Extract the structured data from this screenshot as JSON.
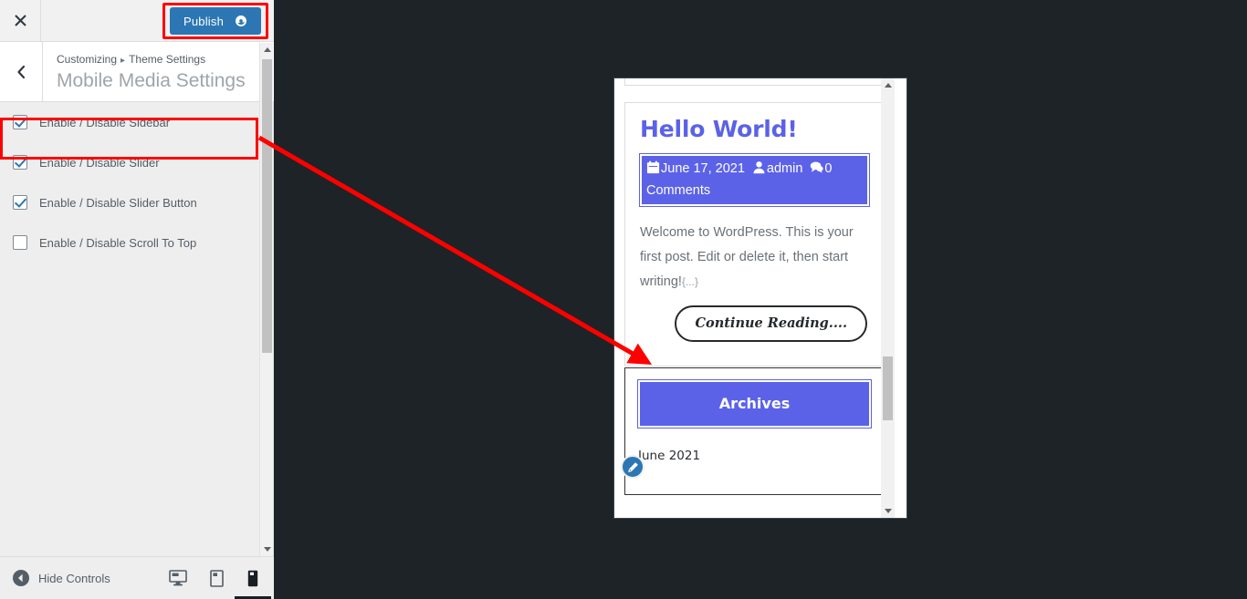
{
  "customizer": {
    "close_icon": "close-icon",
    "publish_label": "Publish",
    "publish_gear_icon": "gear-icon",
    "back_icon": "chevron-left-icon",
    "breadcrumb": {
      "root": "Customizing",
      "separator": "▸",
      "section": "Theme Settings"
    },
    "panel_title": "Mobile Media Settings",
    "options": [
      {
        "label": "Enable / Disable Sidebar",
        "checked": true
      },
      {
        "label": "Enable / Disable Slider",
        "checked": true
      },
      {
        "label": "Enable / Disable Slider Button",
        "checked": true
      },
      {
        "label": "Enable / Disable Scroll To Top",
        "checked": false
      }
    ],
    "footer": {
      "hide_controls_label": "Hide Controls",
      "hide_controls_icon": "collapse-left-icon",
      "devices": [
        {
          "name": "desktop",
          "icon": "desktop-icon",
          "active": false
        },
        {
          "name": "tablet",
          "icon": "tablet-icon",
          "active": false
        },
        {
          "name": "mobile",
          "icon": "mobile-icon",
          "active": true
        }
      ]
    },
    "scrollbar": {
      "up_icon": "scroll-up-arrow-icon",
      "down_icon": "scroll-down-arrow-icon"
    }
  },
  "preview": {
    "device": "mobile",
    "post": {
      "title": "Hello World!",
      "meta": {
        "date_icon": "calendar-icon",
        "date": "June 17, 2021",
        "author_icon": "user-icon",
        "author": "admin",
        "comments_icon": "comment-icon",
        "comments": "0 Comments"
      },
      "excerpt": "Welcome to WordPress. This is your first post. Edit or delete it, then start writing!",
      "excerpt_ellipsis": "{...}",
      "read_more_label": "Continue Reading...."
    },
    "widget": {
      "title": "Archives",
      "items": [
        "June 2021"
      ],
      "edit_icon": "pencil-edit-icon"
    },
    "scrollbar": {
      "up_icon": "scroll-up-arrow-icon",
      "down_icon": "scroll-down-arrow-icon"
    }
  },
  "annotations": {
    "highlight_color": "#ff0000",
    "arrow_color": "#ff0000",
    "highlighted_items": [
      "publish-button",
      "enable-disable-sidebar-option"
    ],
    "arrow_from": "enable-disable-sidebar-option",
    "arrow_to": "archives-widget"
  },
  "colors": {
    "accent_blue": "#2d76b4",
    "theme_blue": "#5b62e8",
    "sidebar_bg": "#eeeeee",
    "stage_bg": "#1d2327"
  }
}
